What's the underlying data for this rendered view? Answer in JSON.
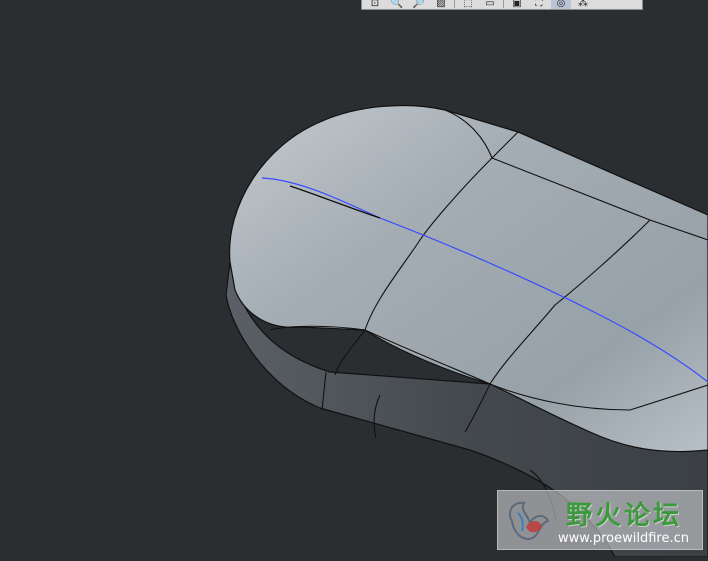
{
  "toolbar": {
    "buttons": [
      {
        "icon": "zoom-window-icon",
        "glyph": "⊡"
      },
      {
        "icon": "zoom-in-icon",
        "glyph": "🔍"
      },
      {
        "icon": "zoom-out-icon",
        "glyph": "🔎"
      },
      {
        "icon": "repaint-icon",
        "glyph": "▨"
      },
      {
        "icon": "view-orientation-icon",
        "glyph": "⬚"
      },
      {
        "icon": "display-style-icon",
        "glyph": "▭"
      },
      {
        "icon": "saved-views-icon",
        "glyph": "▣"
      },
      {
        "icon": "datum-planes-icon",
        "glyph": "⛶"
      },
      {
        "icon": "datum-axes-icon",
        "glyph": "◎"
      },
      {
        "icon": "datum-points-icon",
        "glyph": "⁂"
      }
    ]
  },
  "model": {
    "surface_color": "#9aa3aa",
    "side_color": "#4a4f54",
    "edge_color": "#111111",
    "highlight_curve_color": "#3a4bff"
  },
  "watermark": {
    "title": "野火论坛",
    "url": "www.proewildfire.cn"
  }
}
